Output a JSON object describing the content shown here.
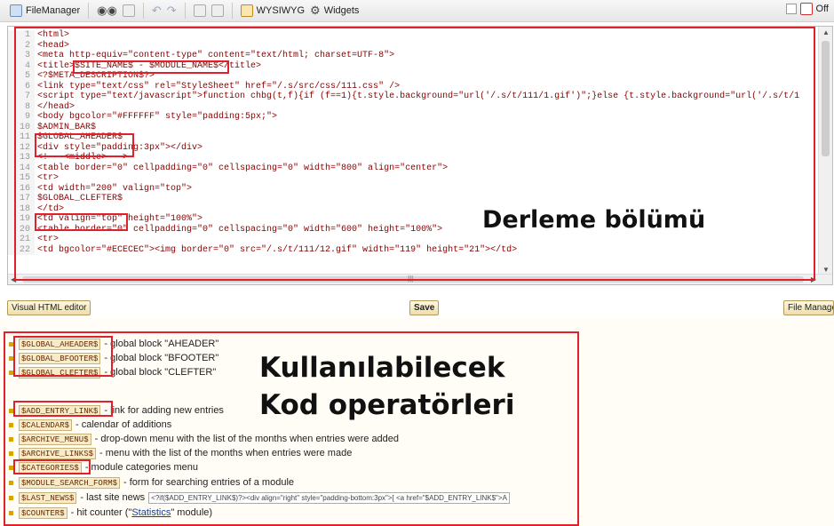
{
  "toolbar": {
    "filemanager_label": "FileManager",
    "wysiwyg_label": "WYSIWYG",
    "widgets_label": "Widgets",
    "off_label": "Off"
  },
  "code_lines": [
    {
      "n": "1",
      "t": "<html>"
    },
    {
      "n": "2",
      "t": "<head>"
    },
    {
      "n": "3",
      "t": "<meta http-equiv=\"content-type\" content=\"text/html; charset=UTF-8\">"
    },
    {
      "n": "4",
      "t": "<title>$SITE_NAME$ - $MODULE_NAME$</title>"
    },
    {
      "n": "5",
      "t": "<?$META_DESCRIPTION$?>"
    },
    {
      "n": "6",
      "t": "<link type=\"text/css\" rel=\"StyleSheet\" href=\"/.s/src/css/111.css\" />"
    },
    {
      "n": "7",
      "t": "<script type=\"text/javascript\">function chbg(t,f){if (f==1){t.style.background=\"url('/.s/t/111/1.gif')\";}else {t.style.background=\"url('/.s/t/1"
    },
    {
      "n": "8",
      "t": "</head>"
    },
    {
      "n": "9",
      "t": "<body bgcolor=\"#FFFFFF\" style=\"padding:5px;\">"
    },
    {
      "n": "10",
      "t": "$ADMIN_BAR$"
    },
    {
      "n": "11",
      "t": "$GLOBAL_AHEADER$"
    },
    {
      "n": "12",
      "t": "<div style=\"padding:3px\"></div>"
    },
    {
      "n": "13",
      "t": "<!-- <middle> -->"
    },
    {
      "n": "14",
      "t": "<table border=\"0\" cellpadding=\"0\" cellspacing=\"0\" width=\"800\" align=\"center\">"
    },
    {
      "n": "15",
      "t": "<tr>"
    },
    {
      "n": "16",
      "t": "<td width=\"200\" valign=\"top\">"
    },
    {
      "n": "17",
      "t": "$GLOBAL_CLEFTER$"
    },
    {
      "n": "18",
      "t": "</td>"
    },
    {
      "n": "19",
      "t": "<td valign=\"top\" height=\"100%\">"
    },
    {
      "n": "20",
      "t": "<table border=\"0\" cellpadding=\"0\" cellspacing=\"0\" width=\"600\" height=\"100%\">"
    },
    {
      "n": "21",
      "t": "<tr>"
    },
    {
      "n": "22",
      "t": "<td bgcolor=\"#ECECEC\"><img border=\"0\" src=\"/.s/t/111/12.gif\" width=\"119\" height=\"21\"></td>"
    }
  ],
  "overlay": {
    "compile_section": "Derleme bölümü",
    "operators_line1": "Kullanılabilecek",
    "operators_line2": "Kod operatörleri"
  },
  "buttons": {
    "visual_html_editor": "Visual HTML editor",
    "save": "Save",
    "file_manager": "File Manager"
  },
  "operators": [
    {
      "tag": "$GLOBAL_AHEADER$",
      "desc": " - global block \"AHEADER\""
    },
    {
      "tag": "$GLOBAL_BFOOTER$",
      "desc": " - global block \"BFOOTER\""
    },
    {
      "tag": "$GLOBAL_CLEFTER$",
      "desc": " - global block \"CLEFTER\""
    },
    {
      "tag": "$ADD_ENTRY_LINK$",
      "desc": " - link for adding new entries"
    },
    {
      "tag": "$CALENDAR$",
      "desc": " - calendar of additions"
    },
    {
      "tag": "$ARCHIVE_MENU$",
      "desc": " - drop-down menu with the list of the months when entries were added"
    },
    {
      "tag": "$ARCHIVE_LINKS$",
      "desc": " - menu with the list of the months when entries were made"
    },
    {
      "tag": "$CATEGORIES$",
      "desc": " - module categories menu"
    },
    {
      "tag": "$MODULE_SEARCH_FORM$",
      "desc": " - form for searching entries of a module"
    },
    {
      "tag": "$LAST_NEWS$",
      "desc": " - last site news",
      "snippet": "<?if($ADD_ENTRY_LINK$)?><div align=\"right\" style=\"padding-bottom:3px\">[ <a href=\"$ADD_ENTRY_LINK$\">A"
    },
    {
      "tag": "$COUNTER$",
      "desc_pre": " - hit counter (\"",
      "link": "Statistics",
      "desc_post": "\" module)"
    }
  ],
  "colors": {
    "highlight": "#e0202a",
    "code_text": "#880000",
    "bullet": "#d9a400"
  }
}
